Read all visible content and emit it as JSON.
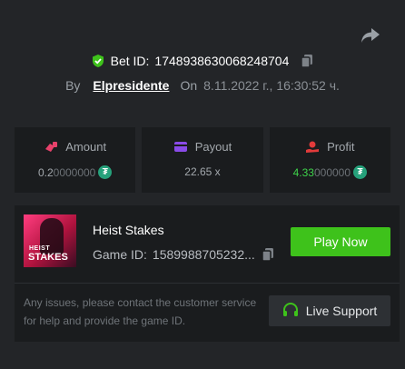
{
  "header": {
    "share_icon": "share-arrow-icon",
    "bet_label": "Bet ID:",
    "bet_id": "1748938630068248704",
    "by_label": "By",
    "username": "Elpresidente",
    "on_label": "On",
    "timestamp": "8.11.2022 г., 16:30:52 ч."
  },
  "stats": {
    "amount": {
      "label": "Amount",
      "value_main": "0.2",
      "value_dim": "0000000",
      "icon": "money-hand-icon"
    },
    "payout": {
      "label": "Payout",
      "value": "22.65 x",
      "icon": "card-icon"
    },
    "profit": {
      "label": "Profit",
      "value_main": "4.33",
      "value_dim": "000000",
      "icon": "coin-hand-icon"
    }
  },
  "game": {
    "title": "Heist Stakes",
    "id_label": "Game ID:",
    "id_value": "1589988705232...",
    "thumb_line1": "HEIST",
    "thumb_line2": "STAKES",
    "play_label": "Play Now"
  },
  "support": {
    "message": "Any issues, please contact the customer service for help and provide the game ID.",
    "button_label": "Live Support",
    "icon": "headset-icon"
  },
  "colors": {
    "background": "#232528",
    "panel": "#1a1c1e",
    "accent_green": "#3ec21b",
    "profit_green": "#3ed34a",
    "tether": "#26a17b",
    "amount_icon": "#e8416b",
    "payout_icon": "#8a4be8",
    "profit_icon": "#e23b3b"
  }
}
